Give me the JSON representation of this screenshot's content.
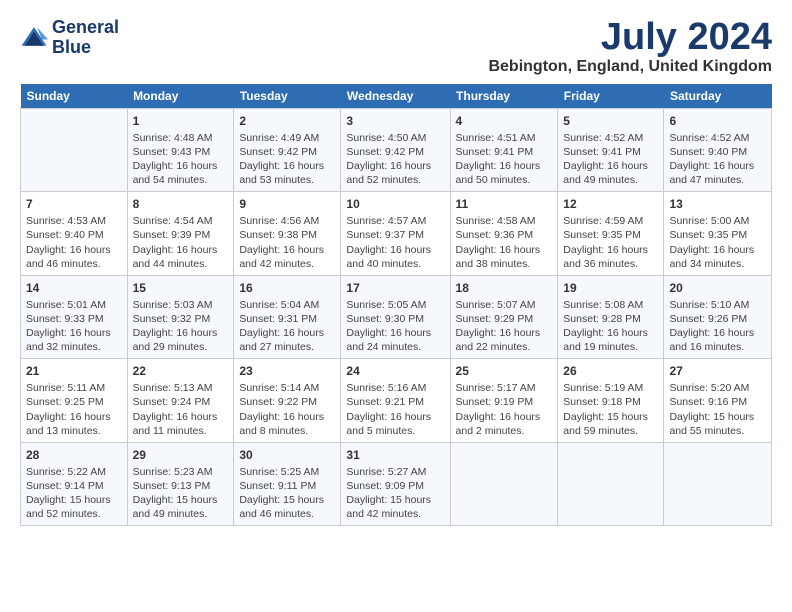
{
  "header": {
    "logo_line1": "General",
    "logo_line2": "Blue",
    "month": "July 2024",
    "location": "Bebington, England, United Kingdom"
  },
  "days_of_week": [
    "Sunday",
    "Monday",
    "Tuesday",
    "Wednesday",
    "Thursday",
    "Friday",
    "Saturday"
  ],
  "weeks": [
    [
      {
        "num": "",
        "sunrise": "",
        "sunset": "",
        "daylight": ""
      },
      {
        "num": "1",
        "sunrise": "Sunrise: 4:48 AM",
        "sunset": "Sunset: 9:43 PM",
        "daylight": "Daylight: 16 hours and 54 minutes."
      },
      {
        "num": "2",
        "sunrise": "Sunrise: 4:49 AM",
        "sunset": "Sunset: 9:42 PM",
        "daylight": "Daylight: 16 hours and 53 minutes."
      },
      {
        "num": "3",
        "sunrise": "Sunrise: 4:50 AM",
        "sunset": "Sunset: 9:42 PM",
        "daylight": "Daylight: 16 hours and 52 minutes."
      },
      {
        "num": "4",
        "sunrise": "Sunrise: 4:51 AM",
        "sunset": "Sunset: 9:41 PM",
        "daylight": "Daylight: 16 hours and 50 minutes."
      },
      {
        "num": "5",
        "sunrise": "Sunrise: 4:52 AM",
        "sunset": "Sunset: 9:41 PM",
        "daylight": "Daylight: 16 hours and 49 minutes."
      },
      {
        "num": "6",
        "sunrise": "Sunrise: 4:52 AM",
        "sunset": "Sunset: 9:40 PM",
        "daylight": "Daylight: 16 hours and 47 minutes."
      }
    ],
    [
      {
        "num": "7",
        "sunrise": "Sunrise: 4:53 AM",
        "sunset": "Sunset: 9:40 PM",
        "daylight": "Daylight: 16 hours and 46 minutes."
      },
      {
        "num": "8",
        "sunrise": "Sunrise: 4:54 AM",
        "sunset": "Sunset: 9:39 PM",
        "daylight": "Daylight: 16 hours and 44 minutes."
      },
      {
        "num": "9",
        "sunrise": "Sunrise: 4:56 AM",
        "sunset": "Sunset: 9:38 PM",
        "daylight": "Daylight: 16 hours and 42 minutes."
      },
      {
        "num": "10",
        "sunrise": "Sunrise: 4:57 AM",
        "sunset": "Sunset: 9:37 PM",
        "daylight": "Daylight: 16 hours and 40 minutes."
      },
      {
        "num": "11",
        "sunrise": "Sunrise: 4:58 AM",
        "sunset": "Sunset: 9:36 PM",
        "daylight": "Daylight: 16 hours and 38 minutes."
      },
      {
        "num": "12",
        "sunrise": "Sunrise: 4:59 AM",
        "sunset": "Sunset: 9:35 PM",
        "daylight": "Daylight: 16 hours and 36 minutes."
      },
      {
        "num": "13",
        "sunrise": "Sunrise: 5:00 AM",
        "sunset": "Sunset: 9:35 PM",
        "daylight": "Daylight: 16 hours and 34 minutes."
      }
    ],
    [
      {
        "num": "14",
        "sunrise": "Sunrise: 5:01 AM",
        "sunset": "Sunset: 9:33 PM",
        "daylight": "Daylight: 16 hours and 32 minutes."
      },
      {
        "num": "15",
        "sunrise": "Sunrise: 5:03 AM",
        "sunset": "Sunset: 9:32 PM",
        "daylight": "Daylight: 16 hours and 29 minutes."
      },
      {
        "num": "16",
        "sunrise": "Sunrise: 5:04 AM",
        "sunset": "Sunset: 9:31 PM",
        "daylight": "Daylight: 16 hours and 27 minutes."
      },
      {
        "num": "17",
        "sunrise": "Sunrise: 5:05 AM",
        "sunset": "Sunset: 9:30 PM",
        "daylight": "Daylight: 16 hours and 24 minutes."
      },
      {
        "num": "18",
        "sunrise": "Sunrise: 5:07 AM",
        "sunset": "Sunset: 9:29 PM",
        "daylight": "Daylight: 16 hours and 22 minutes."
      },
      {
        "num": "19",
        "sunrise": "Sunrise: 5:08 AM",
        "sunset": "Sunset: 9:28 PM",
        "daylight": "Daylight: 16 hours and 19 minutes."
      },
      {
        "num": "20",
        "sunrise": "Sunrise: 5:10 AM",
        "sunset": "Sunset: 9:26 PM",
        "daylight": "Daylight: 16 hours and 16 minutes."
      }
    ],
    [
      {
        "num": "21",
        "sunrise": "Sunrise: 5:11 AM",
        "sunset": "Sunset: 9:25 PM",
        "daylight": "Daylight: 16 hours and 13 minutes."
      },
      {
        "num": "22",
        "sunrise": "Sunrise: 5:13 AM",
        "sunset": "Sunset: 9:24 PM",
        "daylight": "Daylight: 16 hours and 11 minutes."
      },
      {
        "num": "23",
        "sunrise": "Sunrise: 5:14 AM",
        "sunset": "Sunset: 9:22 PM",
        "daylight": "Daylight: 16 hours and 8 minutes."
      },
      {
        "num": "24",
        "sunrise": "Sunrise: 5:16 AM",
        "sunset": "Sunset: 9:21 PM",
        "daylight": "Daylight: 16 hours and 5 minutes."
      },
      {
        "num": "25",
        "sunrise": "Sunrise: 5:17 AM",
        "sunset": "Sunset: 9:19 PM",
        "daylight": "Daylight: 16 hours and 2 minutes."
      },
      {
        "num": "26",
        "sunrise": "Sunrise: 5:19 AM",
        "sunset": "Sunset: 9:18 PM",
        "daylight": "Daylight: 15 hours and 59 minutes."
      },
      {
        "num": "27",
        "sunrise": "Sunrise: 5:20 AM",
        "sunset": "Sunset: 9:16 PM",
        "daylight": "Daylight: 15 hours and 55 minutes."
      }
    ],
    [
      {
        "num": "28",
        "sunrise": "Sunrise: 5:22 AM",
        "sunset": "Sunset: 9:14 PM",
        "daylight": "Daylight: 15 hours and 52 minutes."
      },
      {
        "num": "29",
        "sunrise": "Sunrise: 5:23 AM",
        "sunset": "Sunset: 9:13 PM",
        "daylight": "Daylight: 15 hours and 49 minutes."
      },
      {
        "num": "30",
        "sunrise": "Sunrise: 5:25 AM",
        "sunset": "Sunset: 9:11 PM",
        "daylight": "Daylight: 15 hours and 46 minutes."
      },
      {
        "num": "31",
        "sunrise": "Sunrise: 5:27 AM",
        "sunset": "Sunset: 9:09 PM",
        "daylight": "Daylight: 15 hours and 42 minutes."
      },
      {
        "num": "",
        "sunrise": "",
        "sunset": "",
        "daylight": ""
      },
      {
        "num": "",
        "sunrise": "",
        "sunset": "",
        "daylight": ""
      },
      {
        "num": "",
        "sunrise": "",
        "sunset": "",
        "daylight": ""
      }
    ]
  ]
}
